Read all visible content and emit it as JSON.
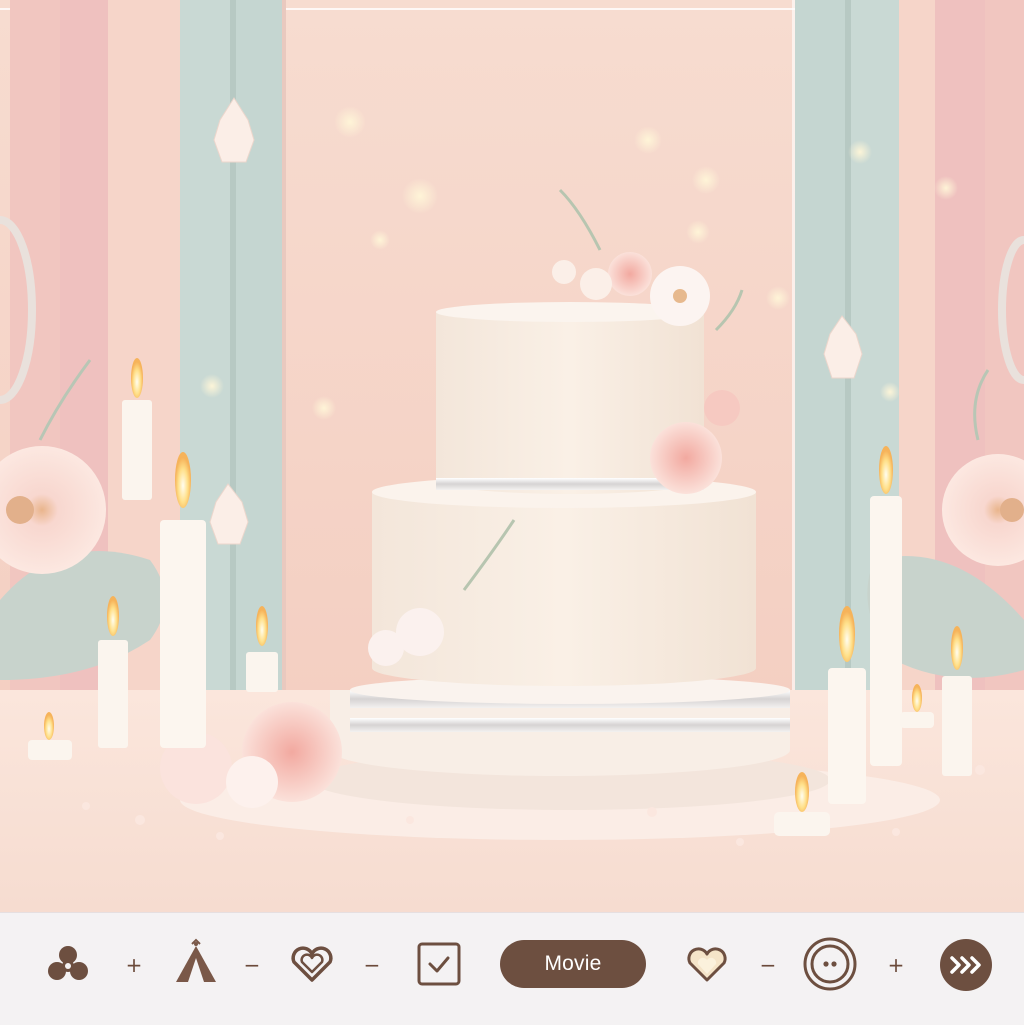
{
  "toolbar": {
    "movie_label": "Movie",
    "separators": [
      "+",
      "−",
      "−",
      "−",
      "+"
    ],
    "icons": [
      "clover-icon",
      "tent-icon",
      "heart-outline-icon",
      "checkbox-icon",
      "heart-gem-icon",
      "record-circle-icon",
      "fast-forward-icon"
    ]
  },
  "colors": {
    "accent_brown": "#6d4f40",
    "toolbar_bg": "#f4f2f3",
    "wall_pink": "#f6d2c4",
    "panel_teal": "#c5d6d1",
    "cake_cream": "#f7ebe0"
  }
}
